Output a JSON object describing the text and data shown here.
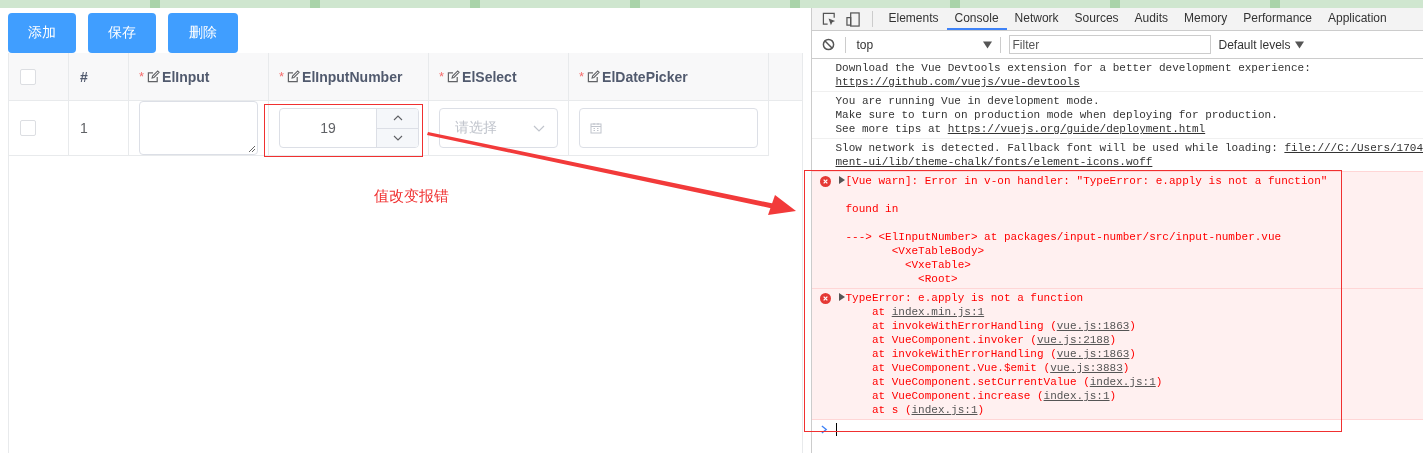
{
  "buttons": [
    {
      "label": "添加"
    },
    {
      "label": "保存"
    },
    {
      "label": "删除"
    }
  ],
  "table": {
    "columns": [
      {
        "kind": "checkbox",
        "checked": false
      },
      {
        "kind": "index",
        "label": "#"
      },
      {
        "kind": "edit",
        "mark": "*",
        "label": "ElInput"
      },
      {
        "kind": "edit",
        "mark": "*",
        "label": "ElInputNumber"
      },
      {
        "kind": "edit",
        "mark": "*",
        "label": "ElSelect"
      },
      {
        "kind": "edit",
        "mark": "*",
        "label": "ElDatePicker"
      }
    ],
    "rows": [
      {
        "cells": [
          {
            "kind": "checkbox",
            "checked": false
          },
          {
            "kind": "index",
            "value": "1"
          },
          {
            "kind": "textarea"
          },
          {
            "kind": "number",
            "value": "19"
          },
          {
            "kind": "select",
            "placeholder": "请选择"
          },
          {
            "kind": "date"
          }
        ]
      }
    ]
  },
  "annotation": {
    "text": "值改变报错"
  },
  "devtools": {
    "tabs": [
      {
        "label": "Elements",
        "selected": false
      },
      {
        "label": "Console",
        "selected": true
      },
      {
        "label": "Network",
        "selected": false
      },
      {
        "label": "Sources",
        "selected": false
      },
      {
        "label": "Audits",
        "selected": false
      },
      {
        "label": "Memory",
        "selected": false
      },
      {
        "label": "Performance",
        "selected": false
      },
      {
        "label": "Application",
        "selected": false
      }
    ],
    "context": "top",
    "filter": {
      "placeholder": "Filter"
    },
    "levels": "Default levels",
    "messages": [
      {
        "kind": "info",
        "lines": [
          {
            "text": "Download the Vue Devtools extension for a better development experience:"
          },
          {
            "link": "https://github.com/vuejs/vue-devtools"
          }
        ]
      },
      {
        "kind": "info",
        "lines": [
          {
            "text": "You are running Vue in development mode."
          },
          {
            "text": "Make sure to turn on production mode when deploying for production."
          },
          {
            "text": "See more tips at ",
            "link": "https://vuejs.org/guide/deployment.html"
          }
        ]
      },
      {
        "kind": "info",
        "lines": [
          {
            "text": "Slow network is detected. Fallback font will be used while loading: ",
            "link": "file:///C:/Users/1704"
          },
          {
            "link": "ment-ui/lib/theme-chalk/fonts/element-icons.woff"
          }
        ]
      },
      {
        "kind": "error",
        "expanded": false,
        "lines": [
          {
            "text": "[Vue warn]: Error in v-on handler: \"TypeError: e.apply is not a function\""
          },
          {
            "kind": "blank"
          },
          {
            "text": "found in"
          },
          {
            "kind": "blank"
          },
          {
            "text": "---> <ElInputNumber> at packages/input-number/src/input-number.vue"
          },
          {
            "text": "       <VxeTableBody>"
          },
          {
            "text": "         <VxeTable>"
          },
          {
            "text": "           <Root>"
          }
        ]
      },
      {
        "kind": "error",
        "expanded": false,
        "lines": [
          {
            "text": "TypeError: e.apply is not a function"
          },
          {
            "text": "    at ",
            "link": "index.min.js:1"
          },
          {
            "text": "    at invokeWithErrorHandling (",
            "link": "vue.js:1863",
            "after": ")"
          },
          {
            "text": "    at VueComponent.invoker (",
            "link": "vue.js:2188",
            "after": ")"
          },
          {
            "text": "    at invokeWithErrorHandling (",
            "link": "vue.js:1863",
            "after": ")"
          },
          {
            "text": "    at VueComponent.Vue.$emit (",
            "link": "vue.js:3883",
            "after": ")"
          },
          {
            "text": "    at VueComponent.setCurrentValue (",
            "link": "index.js:1",
            "after": ")"
          },
          {
            "text": "    at VueComponent.increase (",
            "link": "index.js:1",
            "after": ")"
          },
          {
            "text": "    at s (",
            "link": "index.js:1",
            "after": ")"
          }
        ]
      }
    ]
  }
}
